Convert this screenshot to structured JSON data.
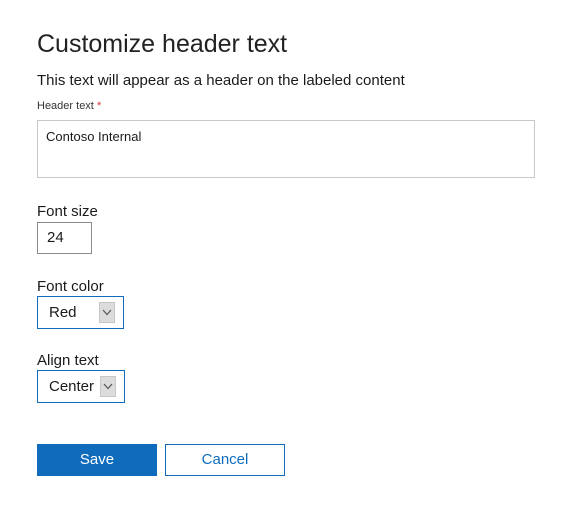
{
  "dialog": {
    "title": "Customize header text",
    "subtitle": "This text will appear as a header on the labeled content"
  },
  "header_text": {
    "label": "Header text",
    "required_mark": "*",
    "value": "Contoso Internal"
  },
  "font_size": {
    "label": "Font size",
    "value": "24"
  },
  "font_color": {
    "label": "Font color",
    "selected": "Red"
  },
  "align_text": {
    "label": "Align text",
    "selected": "Center"
  },
  "actions": {
    "save_label": "Save",
    "cancel_label": "Cancel"
  },
  "colors": {
    "accent": "#0f6cbd",
    "required": "#d13438",
    "border": "#c8c8c8"
  },
  "icons": {
    "dropdown": "chevron-down-icon"
  }
}
